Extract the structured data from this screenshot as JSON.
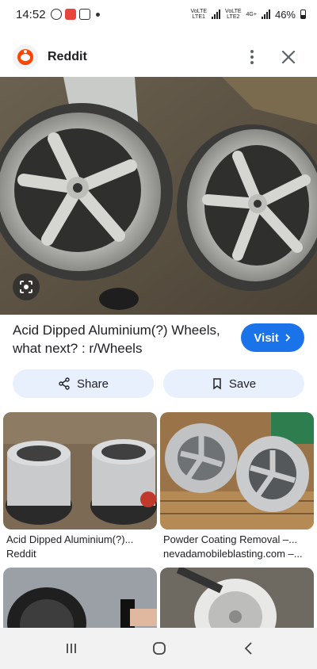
{
  "status": {
    "time": "14:52",
    "sim1_top": "VoLTE",
    "sim1_bottom": "LTE1",
    "sim2_top": "VoLTE",
    "sim2_bottom": "LTE2",
    "net": "4G+",
    "battery": "46%"
  },
  "header": {
    "site": "Reddit"
  },
  "result": {
    "title": "Acid Dipped Aluminium(?) Wheels, what next? : r/Wheels",
    "visit_label": "Visit",
    "share_label": "Share",
    "save_label": "Save"
  },
  "related": [
    {
      "caption": "Acid Dipped Aluminium(?)...",
      "source": "Reddit"
    },
    {
      "caption": "Powder Coating Removal –...",
      "source": "nevadamobileblasting.com –..."
    }
  ],
  "colors": {
    "accent": "#1a73e8",
    "pill": "#e8f0fe",
    "reddit": "#ff4500"
  }
}
